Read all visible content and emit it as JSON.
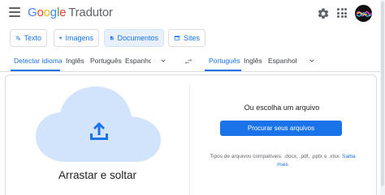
{
  "header": {
    "logo_letters": [
      "G",
      "o",
      "o",
      "g",
      "l",
      "e"
    ],
    "product_name": "Tradutor"
  },
  "modes": [
    {
      "label": "Texto",
      "icon": "translate-icon",
      "active": false
    },
    {
      "label": "Imagens",
      "icon": "image-icon",
      "active": false
    },
    {
      "label": "Documentos",
      "icon": "document-icon",
      "active": true
    },
    {
      "label": "Sites",
      "icon": "web-icon",
      "active": false
    }
  ],
  "source_langs": [
    "Detectar idioma",
    "Inglês",
    "Português",
    "Espanhol"
  ],
  "target_langs": [
    "Português",
    "Inglês",
    "Espanhol"
  ],
  "upload": {
    "drop_text": "Arrastar e soltar",
    "or_text": "Ou escolha um arquivo",
    "browse_label": "Procurar seus arquivos",
    "supported_text": "Tipos de arquivos compatíveis: .docx, .pdf, .pptx e .xlsx.",
    "learn_more": "Saiba mais"
  },
  "colors": {
    "accent": "#1a73e8",
    "cloud": "#d2e3fc",
    "active_mode_bg": "#e8f0fe"
  }
}
